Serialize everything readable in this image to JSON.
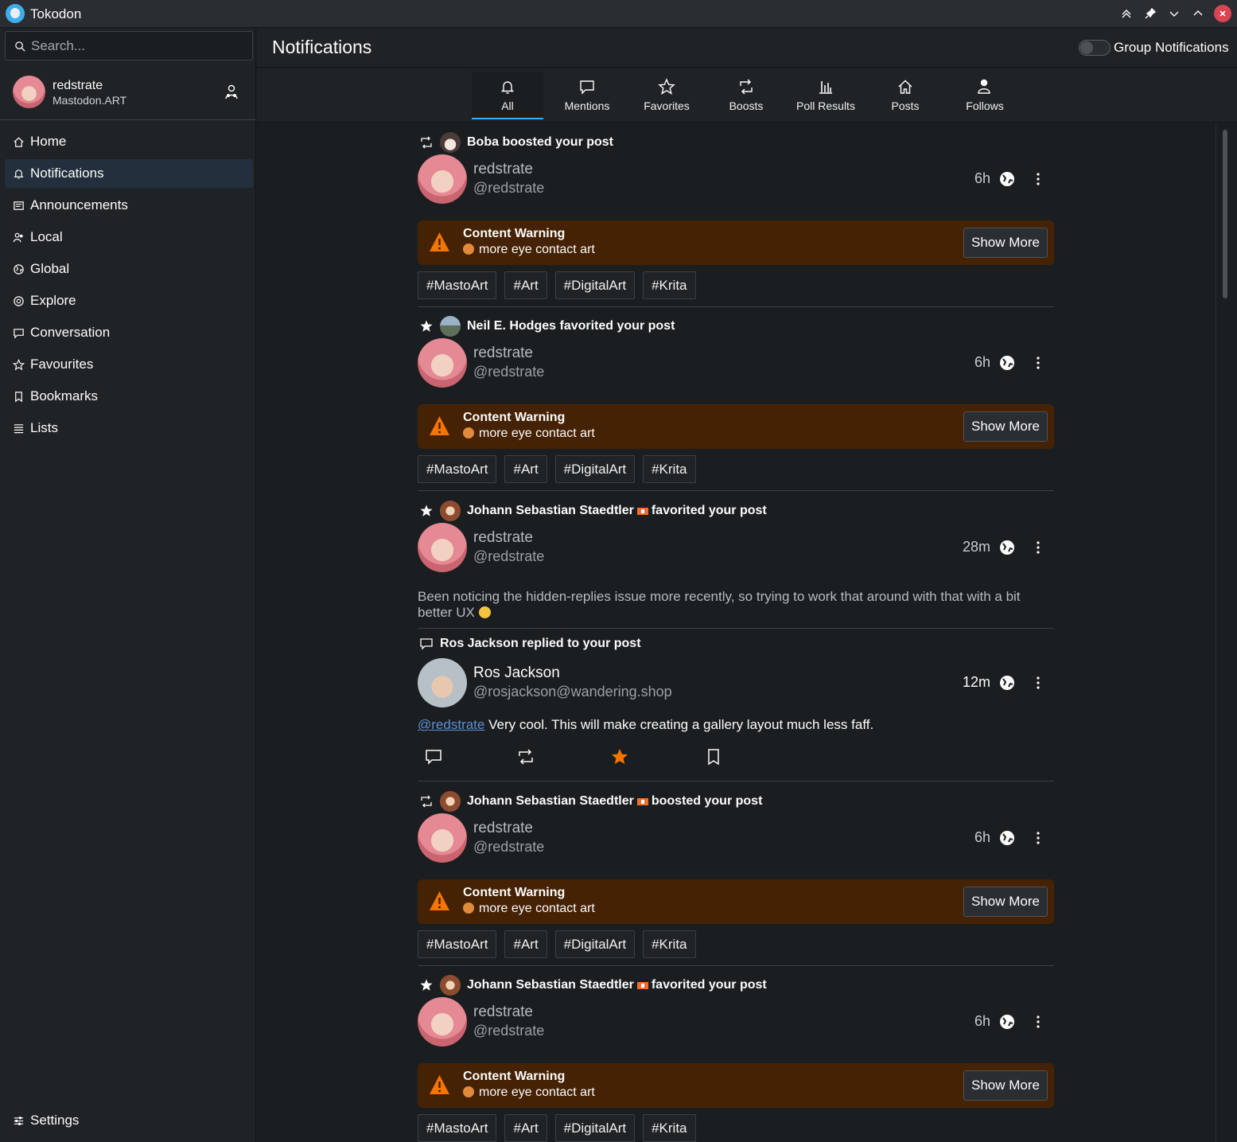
{
  "app": {
    "title": "Tokodon"
  },
  "sidebar": {
    "search_placeholder": "Search...",
    "account": {
      "name": "redstrate",
      "server": "Mastodon.ART"
    },
    "items": [
      {
        "label": "Home",
        "icon": "home-icon"
      },
      {
        "label": "Notifications",
        "icon": "bell-icon",
        "active": true
      },
      {
        "label": "Announcements",
        "icon": "announcement-icon"
      },
      {
        "label": "Local",
        "icon": "users-icon"
      },
      {
        "label": "Global",
        "icon": "globe-icon"
      },
      {
        "label": "Explore",
        "icon": "compass-icon"
      },
      {
        "label": "Conversation",
        "icon": "chat-icon"
      },
      {
        "label": "Favourites",
        "icon": "star-icon"
      },
      {
        "label": "Bookmarks",
        "icon": "bookmark-icon"
      },
      {
        "label": "Lists",
        "icon": "list-icon"
      }
    ],
    "settings_label": "Settings"
  },
  "header": {
    "title": "Notifications",
    "group_label": "Group Notifications",
    "group_on": false
  },
  "tabs": [
    {
      "label": "All",
      "icon": "bell-icon",
      "active": true
    },
    {
      "label": "Mentions",
      "icon": "chat-icon"
    },
    {
      "label": "Favorites",
      "icon": "star-icon"
    },
    {
      "label": "Boosts",
      "icon": "boost-icon"
    },
    {
      "label": "Poll Results",
      "icon": "poll-icon"
    },
    {
      "label": "Posts",
      "icon": "home-icon"
    },
    {
      "label": "Follows",
      "icon": "follow-icon"
    }
  ],
  "content_warning": {
    "title": "Content Warning",
    "text": "more eye contact art",
    "button": "Show More"
  },
  "tags": [
    "#MastoArt",
    "#Art",
    "#DigitalArt",
    "#Krita"
  ],
  "notifications": [
    {
      "type": "boost",
      "actor": "Boba",
      "action": "boosted your post",
      "author": "redstrate",
      "handle": "@redstrate",
      "time": "6h"
    },
    {
      "type": "favorite",
      "actor": "Neil E. Hodges",
      "action": "favorited your post",
      "author": "redstrate",
      "handle": "@redstrate",
      "time": "6h"
    },
    {
      "type": "favorite",
      "actor": "Johann Sebastian Staedtler",
      "action": "favorited your post",
      "author": "redstrate",
      "handle": "@redstrate",
      "time": "28m",
      "text": "Been noticing the hidden-replies issue more recently, so trying to work that around with that with a bit better UX"
    },
    {
      "type": "reply",
      "actor": "Ros Jackson",
      "action": "replied to your post",
      "author": "Ros Jackson",
      "handle": "@rosjackson@wandering.shop",
      "time": "12m",
      "mention": "@redstrate",
      "text": "Very cool. This will make creating a gallery layout much less faff."
    },
    {
      "type": "boost",
      "actor": "Johann Sebastian Staedtler",
      "action": "boosted your post",
      "author": "redstrate",
      "handle": "@redstrate",
      "time": "6h"
    },
    {
      "type": "favorite",
      "actor": "Johann Sebastian Staedtler",
      "action": "favorited your post",
      "author": "redstrate",
      "handle": "@redstrate",
      "time": "6h"
    }
  ],
  "colors": {
    "background": "#1b1e20",
    "sidebar": "#202326",
    "accent": "#3daee9",
    "warning_bg": "#452204",
    "warning_icon": "#f67400",
    "favorite": "#f67400",
    "close": "#da4453"
  }
}
